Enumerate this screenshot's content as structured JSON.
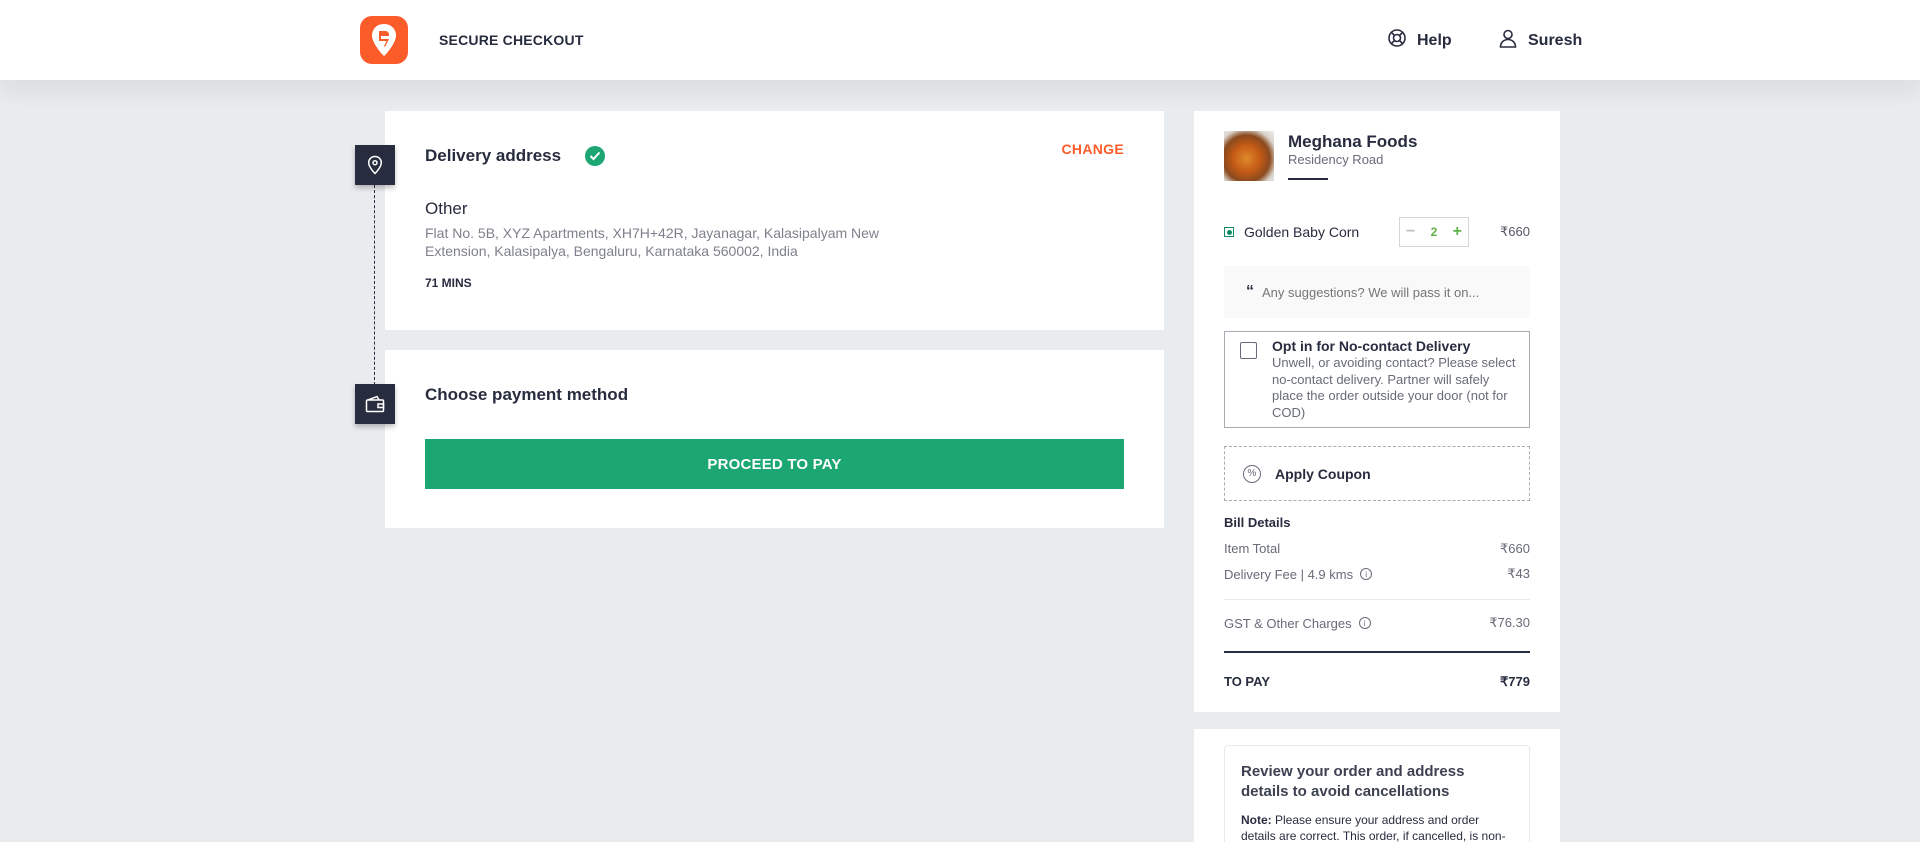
{
  "header": {
    "logo_icon": "swiggy-logo-icon",
    "title": "SECURE CHECKOUT",
    "help_label": "Help",
    "help_icon": "lifebuoy-icon",
    "user_label": "Suresh",
    "user_icon": "user-icon"
  },
  "address": {
    "title": "Delivery address",
    "change_label": "CHANGE",
    "type": "Other",
    "text": "Flat No. 5B, XYZ Apartments, XH7H+42R, Jayanagar, Kalasipalyam New Extension, Kalasipalya, Bengaluru, Karnataka 560002, India",
    "eta": "71 MINS"
  },
  "payment": {
    "title": "Choose payment method",
    "proceed_label": "PROCEED TO PAY"
  },
  "cart": {
    "restaurant_name": "Meghana Foods",
    "restaurant_area": "Residency Road",
    "items": [
      {
        "name": "Golden Baby Corn",
        "quantity": "2",
        "price": "₹660",
        "veg": true
      }
    ],
    "suggestion_placeholder": "Any suggestions? We will pass it on...",
    "no_contact": {
      "title": "Opt in for No-contact Delivery",
      "description": "Unwell, or avoiding contact? Please select no-contact delivery. Partner will safely place the order outside your door (not for COD)"
    },
    "coupon_label": "Apply Coupon",
    "bill": {
      "title": "Bill Details",
      "item_total_label": "Item Total",
      "item_total": "₹660",
      "delivery_label": "Delivery Fee | 4.9 kms",
      "delivery_fee": "₹43",
      "gst_label": "GST & Other Charges",
      "gst": "₹76.30",
      "to_pay_label": "TO PAY",
      "to_pay": "₹779"
    }
  },
  "review": {
    "title": "Review your order and address details to avoid cancellations",
    "note_label": "Note:",
    "note_text": "Please ensure your address and order details are correct. This order, if cancelled, is non-refundable."
  },
  "colors": {
    "brand": "#fc5c2a",
    "success": "#1ba672",
    "text": "#282c3f"
  }
}
